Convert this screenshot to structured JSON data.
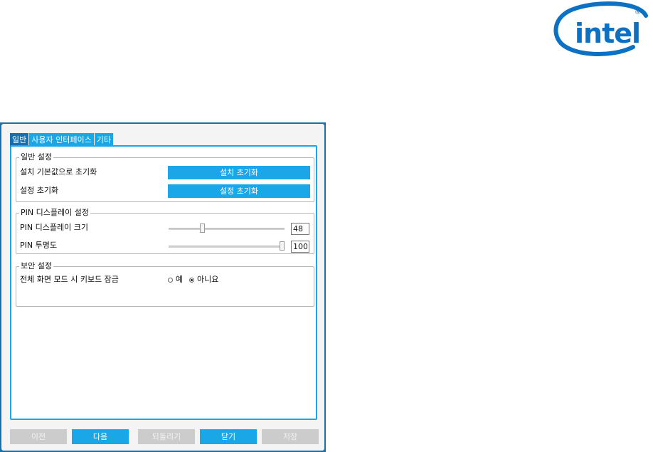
{
  "brand": {
    "logo_text": "intel",
    "logo_color": "#0a71c5"
  },
  "tabs": [
    {
      "label": "일반",
      "active": true
    },
    {
      "label": "사용자 인터페이스",
      "active": false
    },
    {
      "label": "기타",
      "active": false
    }
  ],
  "general": {
    "title": "일반 설정",
    "rows": [
      {
        "label": "설치 기본값으로 초기화",
        "button": "설치 초기화"
      },
      {
        "label": "설정 초기화",
        "button": "설정 초기화"
      }
    ]
  },
  "pin_display": {
    "title": "PIN 디스플레이 설정",
    "size": {
      "label": "PIN 디스플레이 크기",
      "value": "48",
      "slider_fraction": 0.28
    },
    "opacity": {
      "label": "PIN 투명도",
      "value": "100",
      "slider_fraction": 1.0
    }
  },
  "security": {
    "title": "보안 설정",
    "lock_label": "전체 화면 모드 시 키보드 잠금",
    "options": [
      {
        "label": "예",
        "checked": false
      },
      {
        "label": "아니요",
        "checked": true
      }
    ]
  },
  "nav": {
    "prev": "이전",
    "next": "다음",
    "revert": "되돌리기",
    "close": "닫기",
    "save": "저장"
  },
  "colors": {
    "accent": "#1aa7e8",
    "tab_active": "#1470b0",
    "frame": "#1b6fa8",
    "disabled_button": "#cccccc"
  }
}
